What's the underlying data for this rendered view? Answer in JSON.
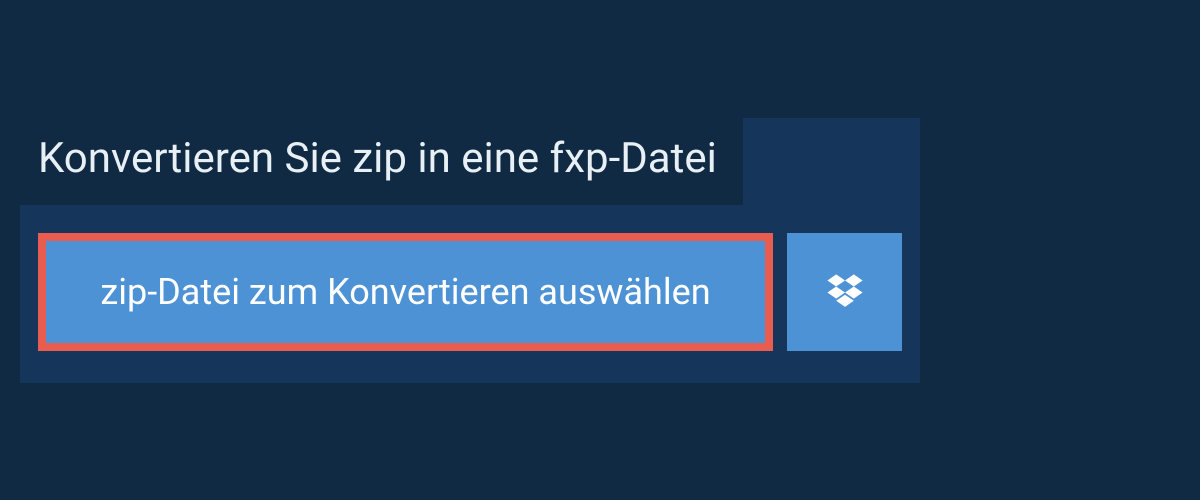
{
  "heading": "Konvertieren Sie zip in eine fxp-Datei",
  "select_button_label": "zip-Datei zum Konvertieren auswählen",
  "icons": {
    "dropbox": "dropbox-icon"
  },
  "colors": {
    "background": "#0f2a42",
    "panel": "#15365a",
    "button": "#4e92d6",
    "highlight_border": "#e95d50",
    "text_light": "#ffffff"
  }
}
